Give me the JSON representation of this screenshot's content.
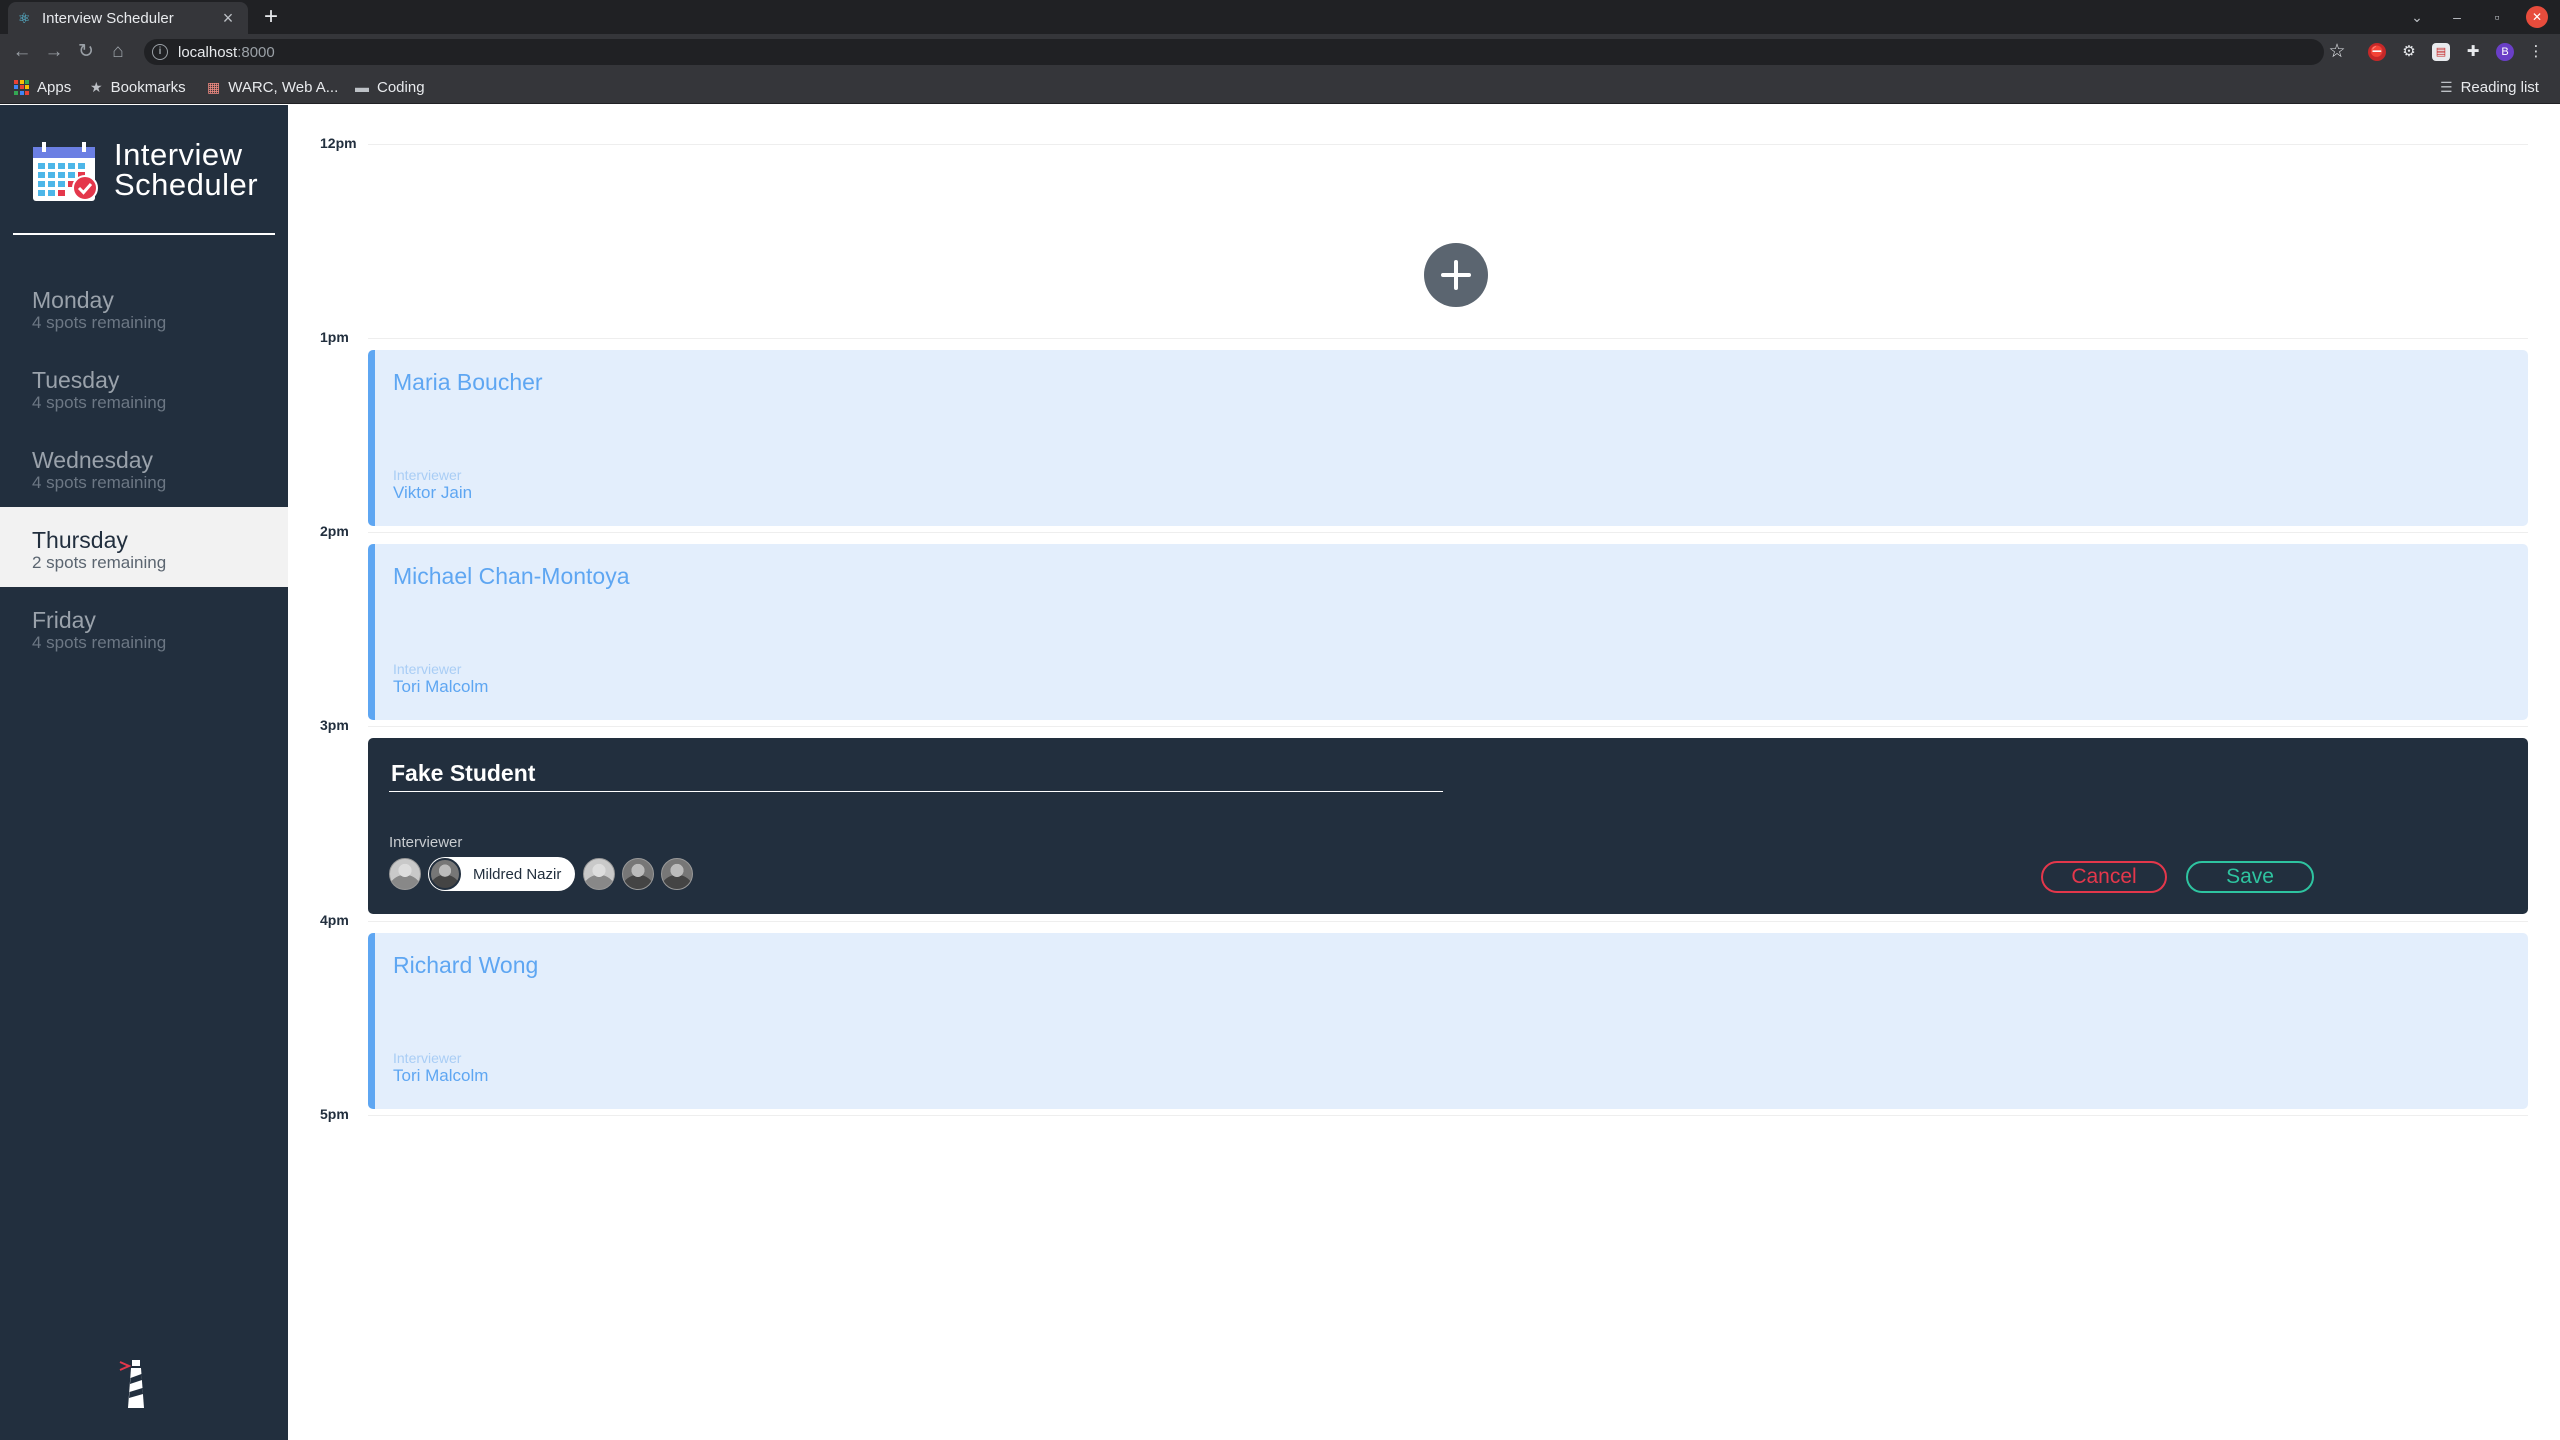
{
  "browser": {
    "tab_title": "Interview Scheduler",
    "url_host": "localhost",
    "url_port": ":8000",
    "bookmarks": [
      "Apps",
      "Bookmarks",
      "WARC, Web A...",
      "Coding"
    ],
    "reading_list": "Reading list",
    "profile_initial": "B"
  },
  "sidebar": {
    "brand_line1": "Interview",
    "brand_line2": "Scheduler",
    "days": [
      {
        "name": "Monday",
        "spots": "4 spots remaining",
        "selected": false
      },
      {
        "name": "Tuesday",
        "spots": "4 spots remaining",
        "selected": false
      },
      {
        "name": "Wednesday",
        "spots": "4 spots remaining",
        "selected": false
      },
      {
        "name": "Thursday",
        "spots": "2 spots remaining",
        "selected": true
      },
      {
        "name": "Friday",
        "spots": "4 spots remaining",
        "selected": false
      }
    ]
  },
  "schedule": {
    "times": [
      "12pm",
      "1pm",
      "2pm",
      "3pm",
      "4pm",
      "5pm"
    ],
    "appointments": [
      {
        "time": "12pm",
        "type": "empty"
      },
      {
        "time": "1pm",
        "type": "show",
        "student": "Maria Boucher",
        "interviewer_label": "Interviewer",
        "interviewer": "Viktor Jain"
      },
      {
        "time": "2pm",
        "type": "show",
        "student": "Michael Chan-Montoya",
        "interviewer_label": "Interviewer",
        "interviewer": "Tori Malcolm"
      },
      {
        "time": "3pm",
        "type": "edit",
        "student": "Fake Student",
        "interviewer_label": "Interviewer",
        "selected_interviewer": "Mildred Nazir",
        "cancel_label": "Cancel",
        "save_label": "Save"
      },
      {
        "time": "4pm",
        "type": "show",
        "student": "Richard Wong",
        "interviewer_label": "Interviewer",
        "interviewer": "Tori Malcolm"
      }
    ]
  },
  "colors": {
    "sidebar_bg": "#222f3e",
    "card_bg": "#e3eefc",
    "card_accent": "#5ea6f2",
    "cancel": "#e4374b",
    "save": "#2ec4a0"
  }
}
